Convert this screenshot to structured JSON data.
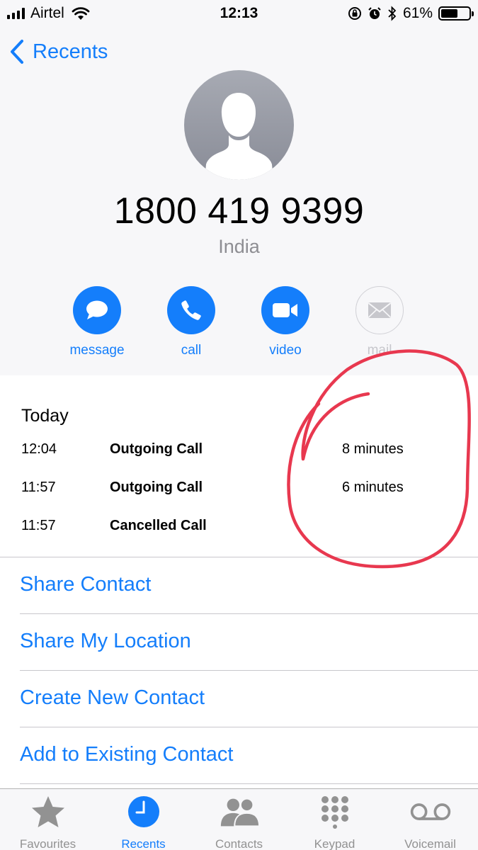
{
  "status_bar": {
    "carrier": "Airtel",
    "time": "12:13",
    "battery": "61%",
    "battery_level": 0.61
  },
  "nav": {
    "back_label": "Recents"
  },
  "contact": {
    "number": "1800 419 9399",
    "country": "India"
  },
  "actions": [
    {
      "label": "message",
      "icon": "message-bubble-icon",
      "enabled": true
    },
    {
      "label": "call",
      "icon": "phone-icon",
      "enabled": true
    },
    {
      "label": "video",
      "icon": "video-camera-icon",
      "enabled": true
    },
    {
      "label": "mail",
      "icon": "envelope-icon",
      "enabled": false
    }
  ],
  "recent_calls": {
    "title": "Today",
    "calls": [
      {
        "time": "12:04",
        "type": "Outgoing Call",
        "duration": "8 minutes"
      },
      {
        "time": "11:57",
        "type": "Outgoing Call",
        "duration": "6 minutes"
      },
      {
        "time": "11:57",
        "type": "Cancelled Call",
        "duration": ""
      }
    ]
  },
  "options": [
    "Share Contact",
    "Share My Location",
    "Create New Contact",
    "Add to Existing Contact"
  ],
  "tab_bar": {
    "active": "Recents",
    "tabs": [
      {
        "label": "Favourites",
        "icon": "star-icon"
      },
      {
        "label": "Recents",
        "icon": "clock-icon"
      },
      {
        "label": "Contacts",
        "icon": "contacts-icon"
      },
      {
        "label": "Keypad",
        "icon": "keypad-icon"
      },
      {
        "label": "Voicemail",
        "icon": "voicemail-icon"
      }
    ]
  },
  "colors": {
    "accent": "#147efb",
    "annotation": "#e8384f",
    "inactive_tab": "#929292",
    "secondary_text": "#8e8e93"
  }
}
